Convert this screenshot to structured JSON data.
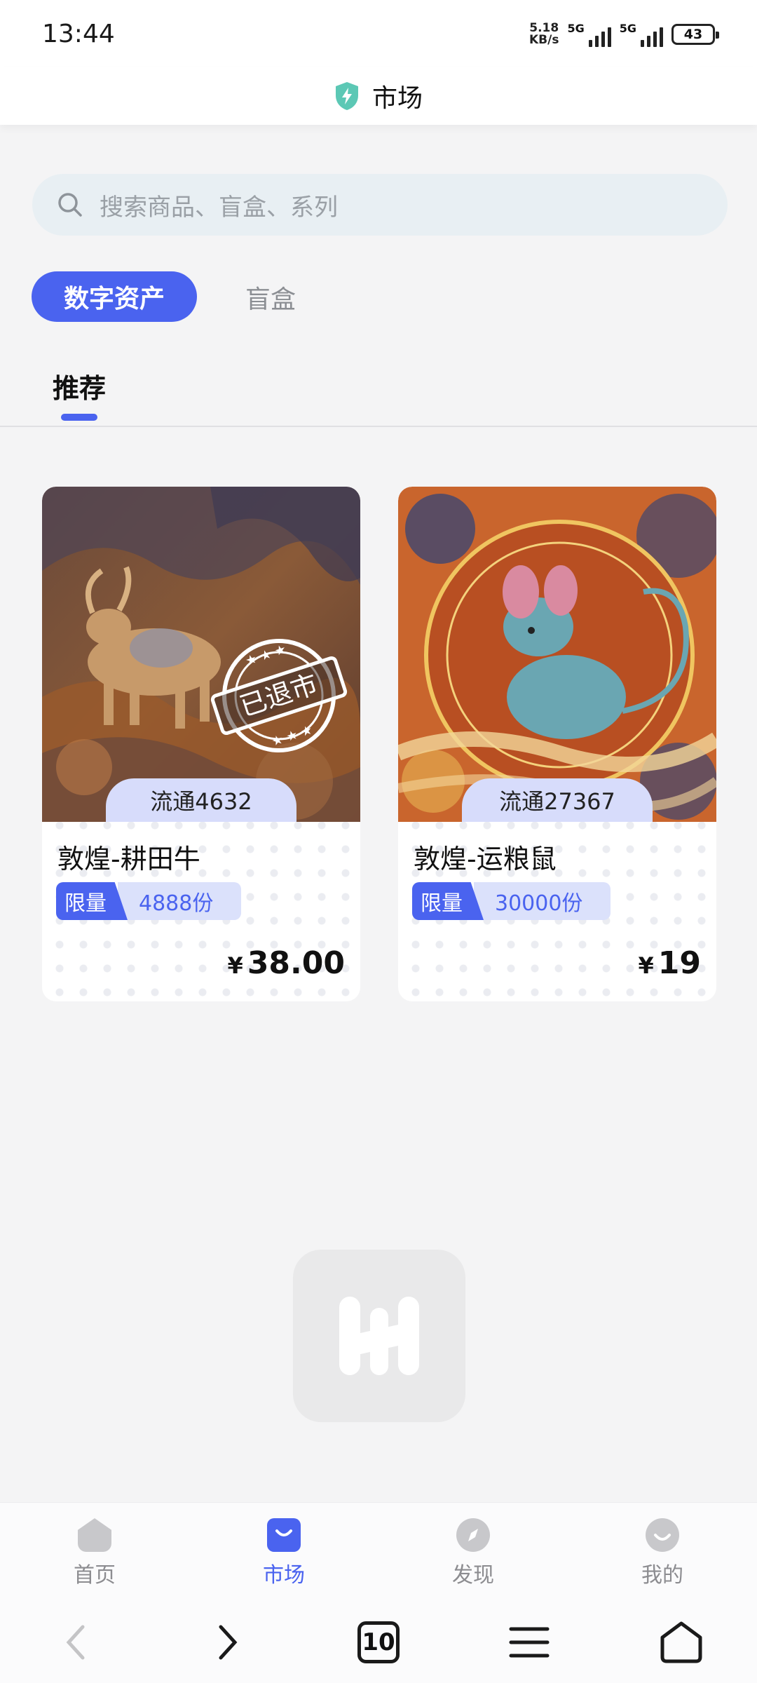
{
  "status_bar": {
    "time": "13:44",
    "net_speed_value": "5.18",
    "net_speed_unit": "KB/s",
    "signal_1": "5G",
    "signal_2": "5G",
    "battery": "43"
  },
  "header": {
    "title": "市场"
  },
  "search": {
    "placeholder": "搜索商品、盲盒、系列"
  },
  "categories": [
    {
      "label": "数字资产",
      "active": true
    },
    {
      "label": "盲盒",
      "active": false
    }
  ],
  "sub_tabs": [
    {
      "label": "推荐",
      "active": true
    }
  ],
  "products": [
    {
      "name": "敦煌-耕田牛",
      "circulation": "流通4632",
      "limit_label": "限量",
      "limit_value": "4888份",
      "currency": "¥",
      "price": "38.00",
      "stamp": "已退市"
    },
    {
      "name": "敦煌-运粮鼠",
      "circulation": "流通27367",
      "limit_label": "限量",
      "limit_value": "30000份",
      "currency": "¥",
      "price": "19"
    }
  ],
  "bottom_nav": [
    {
      "label": "首页",
      "icon": "home-icon",
      "active": false
    },
    {
      "label": "市场",
      "icon": "market-bag-icon",
      "active": true
    },
    {
      "label": "发现",
      "icon": "compass-icon",
      "active": false
    },
    {
      "label": "我的",
      "icon": "profile-icon",
      "active": false
    }
  ],
  "system_nav": {
    "tabs_count": "10"
  },
  "colors": {
    "accent": "#4a63ef",
    "background": "#f4f4f5",
    "tag_light": "#dbe1fb"
  }
}
